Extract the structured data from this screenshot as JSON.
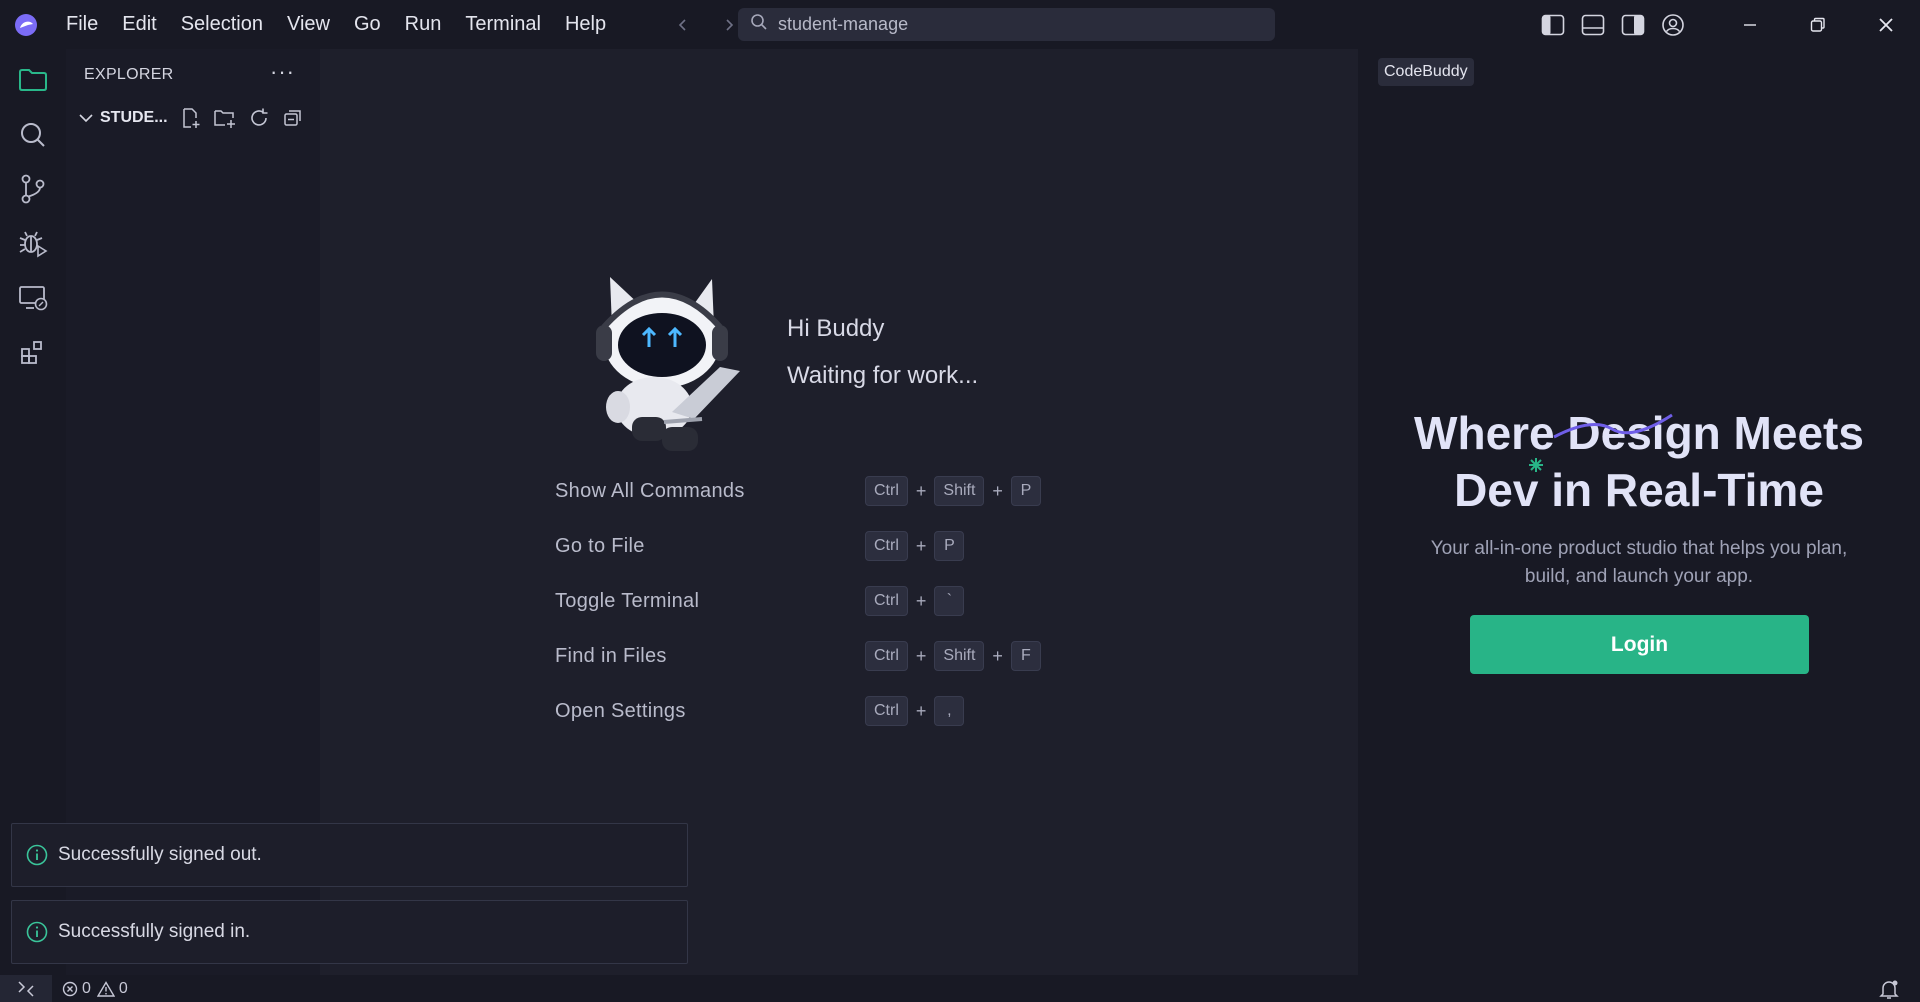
{
  "menu": [
    "File",
    "Edit",
    "Selection",
    "View",
    "Go",
    "Run",
    "Terminal",
    "Help"
  ],
  "search": {
    "text": "student-manage"
  },
  "explorer": {
    "title": "EXPLORER",
    "more": "···",
    "folder": "STUDE..."
  },
  "welcome": {
    "greeting": "Hi Buddy",
    "status": "Waiting for work...",
    "commands": [
      {
        "label": "Show All Commands",
        "keys": [
          "Ctrl",
          "Shift",
          "P"
        ]
      },
      {
        "label": "Go to File",
        "keys": [
          "Ctrl",
          "P"
        ]
      },
      {
        "label": "Toggle Terminal",
        "keys": [
          "Ctrl",
          "`"
        ]
      },
      {
        "label": "Find in Files",
        "keys": [
          "Ctrl",
          "Shift",
          "F"
        ]
      },
      {
        "label": "Open Settings",
        "keys": [
          "Ctrl",
          ","
        ]
      }
    ]
  },
  "panel": {
    "tag": "CodeBuddy",
    "hero_line1": "Where Design Meets",
    "hero_line2": "Dev in Real-Time",
    "subtitle_line1": "Your all-in-one product studio that helps you plan,",
    "subtitle_line2": "build, and launch your app.",
    "login": "Login"
  },
  "notifications": [
    "Successfully signed out.",
    "Successfully signed in."
  ],
  "status": {
    "errors": "0",
    "warnings": "0"
  },
  "colors": {
    "accent": "#28b487",
    "bg": "#1e1f2b",
    "panel": "#181924"
  }
}
